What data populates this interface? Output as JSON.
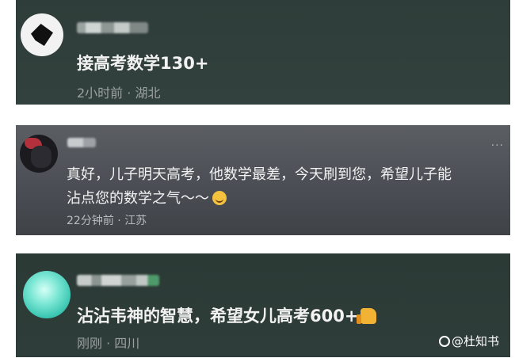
{
  "comments": [
    {
      "text": "接高考数学130+",
      "time": "2小时前",
      "separator": "·",
      "location": "湖北"
    },
    {
      "line1": "真好，儿子明天高考，他数学最差，今天刷到您，希望儿子能",
      "line2": "沾点您的数学之气～～",
      "emoji": "smile-emoji",
      "time": "22分钟前",
      "separator": "·",
      "location": "江苏",
      "more": "···"
    },
    {
      "text": "沾沾韦神的智慧，希望女儿高考600+",
      "emoji": "thumbs-up-emoji",
      "time": "刚刚",
      "separator": "·",
      "location": "四川"
    }
  ],
  "watermark": {
    "text": "@杜知书"
  },
  "colors": {
    "card_dark": "#2f3d3a",
    "card_gray": "#4b4f55",
    "text": "#f2f2f2",
    "meta": "#9aa09e"
  }
}
